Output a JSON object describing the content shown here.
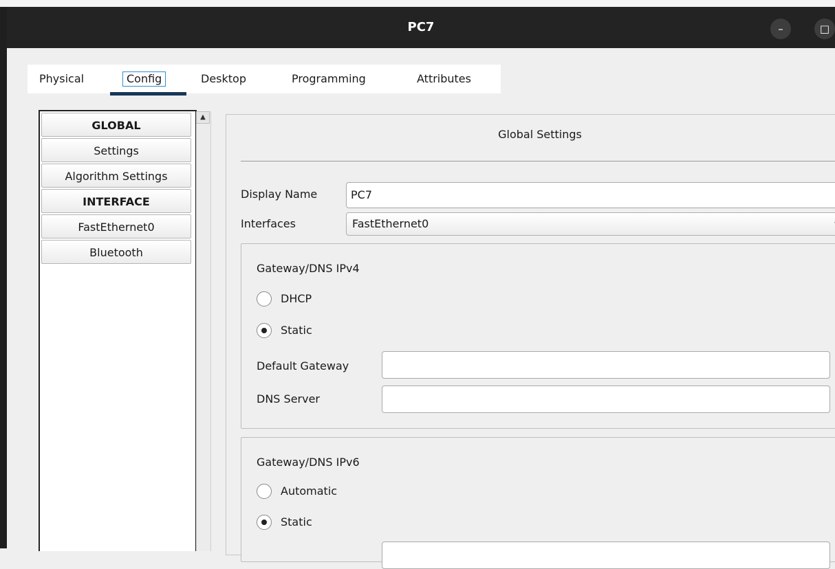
{
  "window": {
    "title": "PC7",
    "minimize_label": "–",
    "maximize_label": "□"
  },
  "tabs": [
    {
      "label": "Physical",
      "active": false
    },
    {
      "label": "Config",
      "active": true
    },
    {
      "label": "Desktop",
      "active": false
    },
    {
      "label": "Programming",
      "active": false
    },
    {
      "label": "Attributes",
      "active": false
    }
  ],
  "nav": {
    "scroll_up_icon": "▲",
    "items": [
      {
        "label": "GLOBAL",
        "type": "header"
      },
      {
        "label": "Settings",
        "type": "item"
      },
      {
        "label": "Algorithm Settings",
        "type": "item"
      },
      {
        "label": "INTERFACE",
        "type": "header"
      },
      {
        "label": "FastEthernet0",
        "type": "item"
      },
      {
        "label": "Bluetooth",
        "type": "item"
      }
    ]
  },
  "global_settings": {
    "title": "Global Settings",
    "display_name_label": "Display Name",
    "display_name_value": "PC7",
    "interfaces_label": "Interfaces",
    "interfaces_value": "FastEthernet0",
    "interfaces_arrow": "▾",
    "ipv4": {
      "title": "Gateway/DNS IPv4",
      "dhcp_label": "DHCP",
      "static_label": "Static",
      "selected": "Static",
      "default_gateway_label": "Default Gateway",
      "default_gateway_value": "",
      "dns_server_label": "DNS Server",
      "dns_server_value": ""
    },
    "ipv6": {
      "title": "Gateway/DNS IPv6",
      "automatic_label": "Automatic",
      "static_label": "Static",
      "selected": "Static"
    }
  },
  "colors": {
    "titlebar": "#232323",
    "active_tab_underline": "#173758",
    "focus_outline": "#2f8fd0"
  }
}
